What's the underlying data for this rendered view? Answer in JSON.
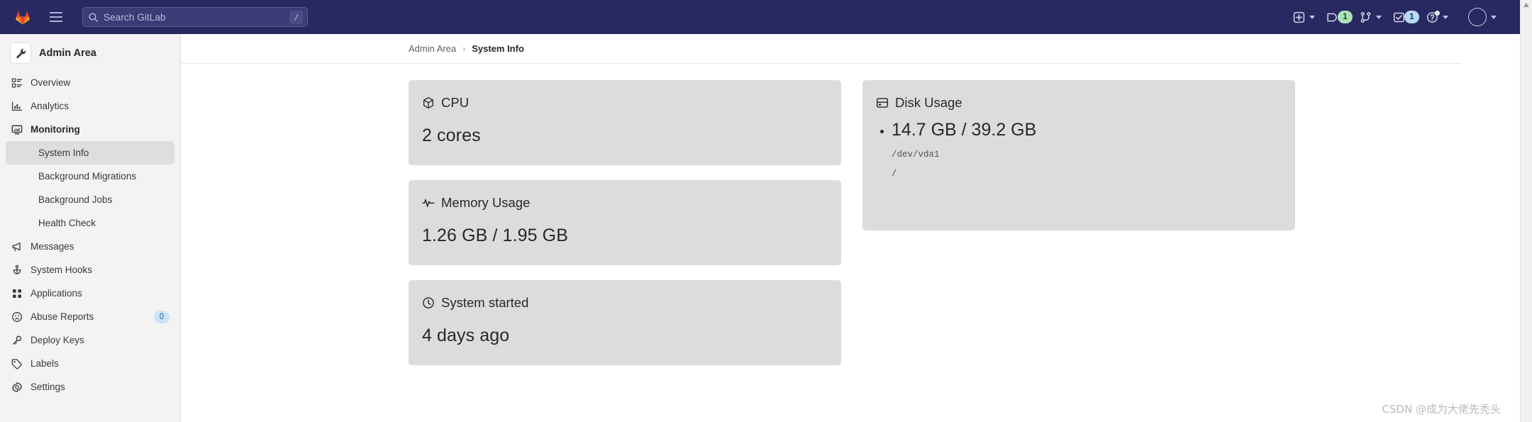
{
  "topbar": {
    "logo_icon": "gitlab-logo-icon",
    "menu_icon": "hamburger-menu-icon",
    "search": {
      "icon": "search-icon",
      "placeholder": "Search GitLab",
      "shortcut_key": "/"
    },
    "actions": [
      {
        "name": "create-new-menu",
        "icon": "plus-square-icon",
        "badge": null,
        "chevron": true
      },
      {
        "name": "issues-menu",
        "icon": "issues-icon",
        "badge": "1",
        "badge_color": "#aee1b9",
        "chevron": false
      },
      {
        "name": "merge-requests-menu",
        "icon": "merge-request-icon",
        "badge": null,
        "chevron": true
      },
      {
        "name": "todos-menu",
        "icon": "todo-checkbox-icon",
        "badge": "1",
        "badge_color": "#b8d9f5",
        "chevron": false
      },
      {
        "name": "help-menu",
        "icon": "question-circle-icon",
        "badge": null,
        "chevron": true
      },
      {
        "name": "user-avatar-menu",
        "icon": "avatar-icon",
        "badge": null,
        "chevron": true
      }
    ]
  },
  "sidebar": {
    "context": {
      "title": "Admin Area",
      "icon": "wrench-icon"
    },
    "items": [
      {
        "label": "Overview",
        "icon": "overview-icon",
        "level": "top",
        "active": false,
        "badge": null
      },
      {
        "label": "Analytics",
        "icon": "analytics-icon",
        "level": "top",
        "active": false,
        "badge": null
      },
      {
        "label": "Monitoring",
        "icon": "monitor-icon",
        "level": "top",
        "active": false,
        "badge": null,
        "expanded": true
      },
      {
        "label": "System Info",
        "icon": null,
        "level": "sub",
        "active": true,
        "badge": null
      },
      {
        "label": "Background Migrations",
        "icon": null,
        "level": "sub",
        "active": false,
        "badge": null
      },
      {
        "label": "Background Jobs",
        "icon": null,
        "level": "sub",
        "active": false,
        "badge": null
      },
      {
        "label": "Health Check",
        "icon": null,
        "level": "sub",
        "active": false,
        "badge": null
      },
      {
        "label": "Messages",
        "icon": "megaphone-icon",
        "level": "top",
        "active": false,
        "badge": null
      },
      {
        "label": "System Hooks",
        "icon": "hook-icon",
        "level": "top",
        "active": false,
        "badge": null
      },
      {
        "label": "Applications",
        "icon": "apps-grid-icon",
        "level": "top",
        "active": false,
        "badge": null
      },
      {
        "label": "Abuse Reports",
        "icon": "sad-face-icon",
        "level": "top",
        "active": false,
        "badge": "0"
      },
      {
        "label": "Deploy Keys",
        "icon": "key-icon",
        "level": "top",
        "active": false,
        "badge": null
      },
      {
        "label": "Labels",
        "icon": "label-tag-icon",
        "level": "top",
        "active": false,
        "badge": null
      },
      {
        "label": "Settings",
        "icon": "gear-icon",
        "level": "top",
        "active": false,
        "badge": null
      }
    ]
  },
  "breadcrumb": {
    "parent": "Admin Area",
    "separator": "›",
    "current": "System Info"
  },
  "cards": {
    "cpu": {
      "title": "CPU",
      "icon": "cube-icon",
      "value": "2 cores"
    },
    "memory": {
      "title": "Memory Usage",
      "icon": "pulse-icon",
      "value": "1.26 GB / 1.95 GB"
    },
    "uptime": {
      "title": "System started",
      "icon": "clock-icon",
      "value": "4 days ago"
    },
    "disk": {
      "title": "Disk Usage",
      "icon": "disk-icon",
      "entries": [
        {
          "value": "14.7 GB / 39.2 GB",
          "device": "/dev/vda1",
          "mount": "/"
        }
      ]
    }
  },
  "watermark": "CSDN @成为大佬先秃头"
}
